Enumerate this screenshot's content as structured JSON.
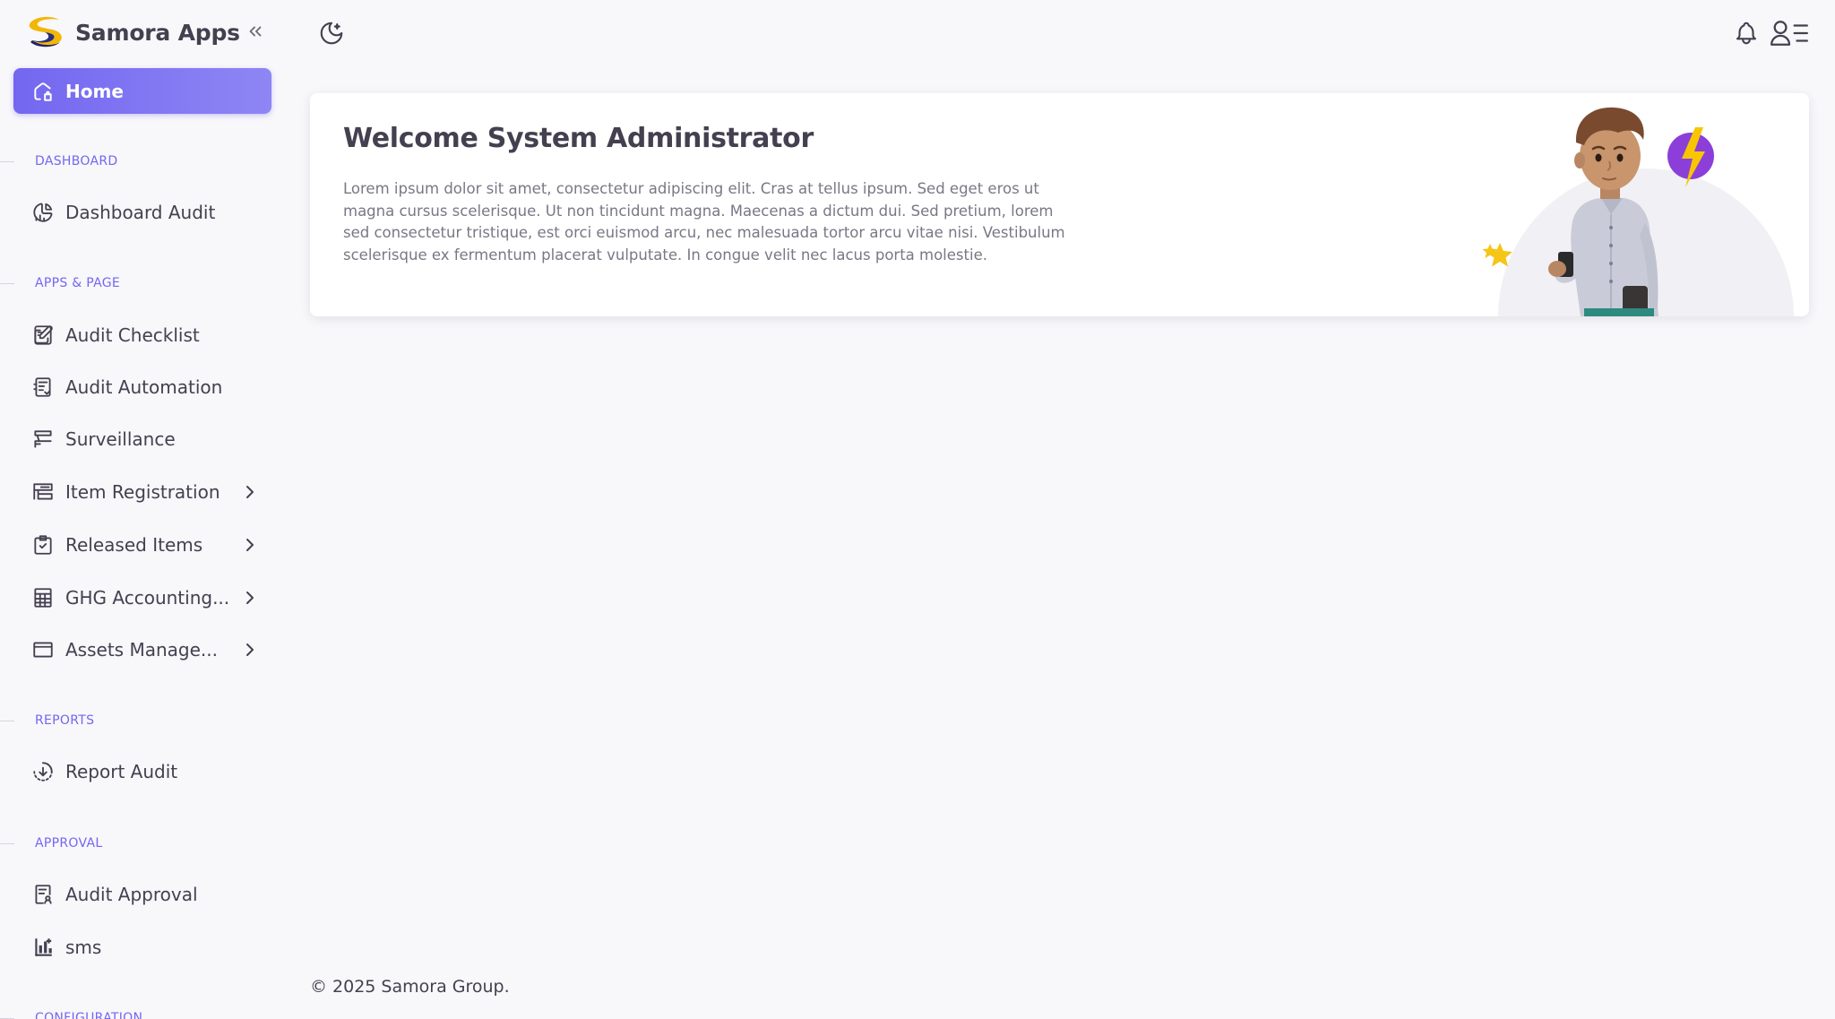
{
  "brand": {
    "name": "Samora Apps"
  },
  "sidebar": {
    "home": "Home",
    "sections": {
      "dashboard": "DASHBOARD",
      "apps": "APPS & PAGE",
      "reports": "REPORTS",
      "approval": "APPROVAL",
      "configuration": "CONFIGURATION"
    },
    "items": {
      "dashboard_audit": "Dashboard Audit",
      "audit_checklist": "Audit Checklist",
      "audit_automation": "Audit Automation",
      "surveillance": "Surveillance",
      "item_registration": "Item Registration",
      "released_items": "Released Items",
      "ghg_accounting": "GHG Accounting...",
      "assets_management": "Assets Manage...",
      "report_audit": "Report Audit",
      "audit_approval": "Audit Approval",
      "sms": "sms"
    }
  },
  "welcome": {
    "prefix": "Welcome ",
    "user": "System Administrator",
    "text": "Lorem ipsum dolor sit amet, consectetur adipiscing elit. Cras at tellus ipsum. Sed eget eros ut magna cursus scelerisque. Ut non tincidunt magna. Maecenas a dictum dui. Sed pretium, lorem sed consectetur tristique, est orci euismod arcu, nec malesuada tortor arcu vitae nisi. Vestibulum scelerisque ex fermentum placerat vulputate. In congue velit nec lacus porta molestie."
  },
  "footer": {
    "text": "© 2025 Samora Group."
  },
  "colors": {
    "accent": "#7367f0",
    "text": "#444050",
    "muted": "#7a7785",
    "background": "#f8f7fa"
  }
}
